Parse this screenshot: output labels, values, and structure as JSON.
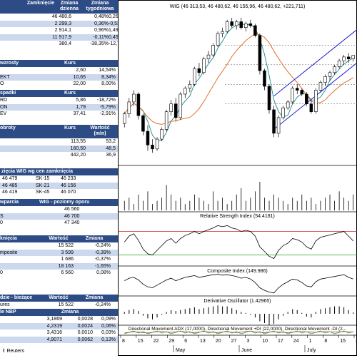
{
  "sections": [
    {
      "id": "indices",
      "headers": [
        "Zamknięcie",
        "Zmiana dzienna",
        "Zmiana tygodniowa"
      ],
      "rows": [
        [
          "",
          "46 480,6",
          "0,48%",
          "0,26%"
        ],
        [
          "",
          "2 299,3",
          "0,36%",
          "-0,53%"
        ],
        [
          "",
          "2 914,1",
          "0,96%",
          "1,49%"
        ],
        [
          "",
          "11 917,9",
          "-0,11%",
          "0,45%"
        ],
        [
          "",
          "380,4",
          "-38,35%",
          "-12,79%"
        ]
      ]
    },
    {
      "id": "gainers",
      "headers": [
        "wzrosty",
        "Kurs",
        ""
      ],
      "rows": [
        [
          "",
          "2,60",
          "14,54%"
        ],
        [
          "EKT",
          "10,65",
          "8,34%"
        ],
        [
          "O",
          "22,00",
          "8,00%"
        ]
      ]
    },
    {
      "id": "losers",
      "headers": [
        "spadki",
        "Kurs",
        ""
      ],
      "rows": [
        [
          "RD",
          "5,86",
          "-18,72%"
        ],
        [
          "ON",
          "1,79",
          "-5,79%"
        ],
        [
          "EV",
          "37,41",
          "-2,91%"
        ]
      ]
    },
    {
      "id": "turnover",
      "headers": [
        "obroty",
        "Kurs",
        "Wartość (mln)"
      ],
      "rows": [
        [
          "",
          "113,55",
          "53,2"
        ],
        [
          "",
          "160,50",
          "48,5"
        ],
        [
          "",
          "442,20",
          "36,9"
        ]
      ]
    },
    {
      "id": "wig_close",
      "headers": [
        "zięcia WIG wg cen zamknięcia"
      ],
      "rows": [
        [
          "46 479",
          "SK-15",
          "46 233"
        ],
        [
          "46 485",
          "SK-21",
          "46 156"
        ],
        [
          "46 419",
          "SK-45",
          "46 070"
        ]
      ]
    },
    {
      "id": "sr",
      "headers": [
        "wparcia",
        "WIG - poziomy oporu"
      ],
      "rows": [
        [
          "",
          "46 560"
        ],
        [
          "S",
          "46 700"
        ],
        [
          "0",
          "47 340"
        ]
      ]
    },
    {
      "id": "futures",
      "headers": [
        "knięcia",
        "Wartość",
        "Zmiana"
      ],
      "rows": [
        [
          "",
          "15 522",
          "-0,24%"
        ],
        [
          "mposite",
          "3 599",
          "-0,39%"
        ],
        [
          "",
          "1 686",
          "-0,37%"
        ],
        [
          "",
          "18 163",
          "-1,65%"
        ],
        [
          "0",
          "6 560",
          "0,08%"
        ]
      ]
    },
    {
      "id": "futures_now",
      "headers": [
        "dzie - bieżące",
        "Wartość",
        "Zmiana"
      ],
      "rows": [
        [
          "ures",
          "15 522",
          "-0,24%"
        ],
        [
          "tures",
          "3 069",
          "0,00%"
        ]
      ]
    },
    {
      "id": "nbp",
      "headers": [
        "le NBP",
        "Zmiana",
        ""
      ],
      "rows": [
        [
          "",
          "3,1869",
          "0,0028",
          "0,09%"
        ],
        [
          "",
          "4,2319",
          "0,0024",
          "0,06%"
        ],
        [
          "",
          "3,4316",
          "0,0010",
          "0,03%"
        ],
        [
          "",
          "4,9071",
          "0,0062",
          "0,13%"
        ]
      ]
    }
  ],
  "footer": "ł: Reuters",
  "chart_data": [
    {
      "type": "candlestick",
      "title": "WIG (46 313,53, 46 480,62, 46 155,96, 46 480,62, +221,711)",
      "price_levels": [
        44000,
        45000,
        46000,
        47000
      ],
      "candles": [
        [
          43000,
          43600,
          42800,
          43500
        ],
        [
          43500,
          44300,
          43300,
          44100
        ],
        [
          44100,
          44700,
          43900,
          44500
        ],
        [
          44500,
          44600,
          43200,
          43400
        ],
        [
          43400,
          43500,
          42400,
          42600
        ],
        [
          42600,
          42900,
          41600,
          41900
        ],
        [
          41900,
          42200,
          41500,
          41700
        ],
        [
          41700,
          42300,
          41600,
          42200
        ],
        [
          42200,
          42800,
          42100,
          42700
        ],
        [
          42700,
          43700,
          42600,
          43600
        ],
        [
          43600,
          44200,
          43400,
          44000
        ],
        [
          44000,
          44300,
          43100,
          43300
        ],
        [
          43300,
          44600,
          43200,
          44500
        ],
        [
          44500,
          44900,
          44300,
          44800
        ],
        [
          44800,
          45200,
          44600,
          45000
        ],
        [
          45000,
          45900,
          44900,
          45800
        ],
        [
          45800,
          46100,
          45400,
          45600
        ],
        [
          45600,
          46400,
          45500,
          46300
        ],
        [
          46300,
          46700,
          46100,
          46500
        ],
        [
          46500,
          47100,
          46400,
          47000
        ],
        [
          47000,
          47700,
          46900,
          47600
        ],
        [
          47600,
          47900,
          47400,
          47700
        ],
        [
          47700,
          48300,
          47600,
          48200
        ],
        [
          48200,
          48400,
          47900,
          48000
        ],
        [
          48000,
          48300,
          47800,
          48200
        ],
        [
          48200,
          48400,
          47800,
          47900
        ],
        [
          47900,
          48200,
          47700,
          48100
        ],
        [
          48100,
          48300,
          47900,
          48000
        ],
        [
          48000,
          48100,
          47400,
          47500
        ],
        [
          47500,
          47600,
          45500,
          45700
        ],
        [
          45700,
          45800,
          44700,
          44900
        ],
        [
          44900,
          45000,
          43500,
          43700
        ],
        [
          43700,
          43900,
          42300,
          42500
        ],
        [
          42500,
          43400,
          42300,
          43300
        ],
        [
          43300,
          43900,
          43200,
          43800
        ],
        [
          43800,
          44200,
          43700,
          44100
        ],
        [
          44100,
          44900,
          44000,
          44800
        ],
        [
          44800,
          45000,
          44500,
          44700
        ],
        [
          44700,
          44800,
          44400,
          44500
        ],
        [
          44500,
          44600,
          43900,
          44000
        ],
        [
          44000,
          44200,
          43500,
          43600
        ],
        [
          43600,
          44800,
          43500,
          44700
        ],
        [
          44700,
          45200,
          44600,
          45100
        ],
        [
          45100,
          45500,
          44900,
          45400
        ],
        [
          45400,
          45700,
          45200,
          45600
        ],
        [
          45600,
          46000,
          45500,
          45900
        ],
        [
          45900,
          46300,
          45800,
          46200
        ],
        [
          46200,
          46500,
          46000,
          46400
        ],
        [
          46400,
          46600,
          46100,
          46300
        ],
        [
          46313,
          46481,
          46156,
          46481
        ]
      ],
      "moving_averages": [
        {
          "name": "MA short",
          "color": "#1a8a8a"
        },
        {
          "name": "MA long",
          "color": "#e0601a"
        }
      ],
      "trend_channel": {
        "color": "#2020d0"
      }
    },
    {
      "type": "line",
      "title": "Relative Strength Index (54.4181)",
      "levels": [
        30,
        70
      ],
      "values": [
        52,
        62,
        66,
        55,
        40,
        32,
        30,
        38,
        46,
        54,
        58,
        50,
        58,
        63,
        66,
        70,
        66,
        70,
        73,
        76,
        80,
        78,
        80,
        76,
        74,
        70,
        72,
        70,
        62,
        44,
        36,
        28,
        24,
        38,
        46,
        50,
        58,
        56,
        52,
        44,
        40,
        54,
        60,
        62,
        64,
        66,
        68,
        70,
        62,
        54
      ]
    },
    {
      "type": "line",
      "title": "Composite Index (149.986)",
      "values": [
        20,
        50,
        60,
        30,
        -20,
        -50,
        -60,
        -30,
        0,
        30,
        50,
        20,
        40,
        60,
        70,
        80,
        60,
        70,
        80,
        90,
        95,
        85,
        90,
        80,
        70,
        50,
        60,
        40,
        0,
        -60,
        -90,
        -110,
        -120,
        -60,
        -20,
        10,
        40,
        30,
        0,
        -40,
        -50,
        10,
        40,
        50,
        60,
        70,
        80,
        90,
        60,
        40
      ]
    },
    {
      "type": "bar",
      "title": "Derivative Oscillator (1.42965)",
      "values": [
        2,
        4,
        5,
        3,
        -2,
        -5,
        -6,
        -4,
        -1,
        2,
        4,
        3,
        4,
        5,
        6,
        7,
        5,
        6,
        7,
        8,
        9,
        8,
        8,
        6,
        4,
        2,
        1,
        -1,
        -4,
        -8,
        -10,
        -12,
        -11,
        -6,
        -2,
        2,
        5,
        4,
        1,
        -3,
        -4,
        2,
        5,
        6,
        7,
        8,
        8,
        7,
        4,
        1.4
      ]
    },
    {
      "type": "line",
      "title": "Directional Movement ADX (17,0000), Directional Movement +DI (22,0000), Directional Movement -DI (2..."
    },
    {
      "type": "bar",
      "title": "volume",
      "values": [
        3,
        4,
        2,
        5,
        3,
        6,
        2,
        3,
        4,
        8,
        5,
        3,
        4,
        2,
        3,
        5,
        4,
        3,
        2,
        6,
        3,
        4,
        2,
        3,
        5,
        7,
        3,
        4,
        6,
        9,
        4,
        3,
        5,
        4,
        3,
        2,
        4,
        3,
        5,
        3,
        4,
        2,
        3,
        4,
        5,
        3,
        6,
        4,
        3,
        5
      ]
    }
  ],
  "x_axis": {
    "day_labels": [
      "8",
      "15",
      "22",
      "29",
      "6",
      "13",
      "20",
      "27",
      "3",
      "10",
      "17",
      "24",
      "1",
      "8",
      "15",
      "2"
    ],
    "months": [
      "May",
      "June",
      "July"
    ]
  }
}
